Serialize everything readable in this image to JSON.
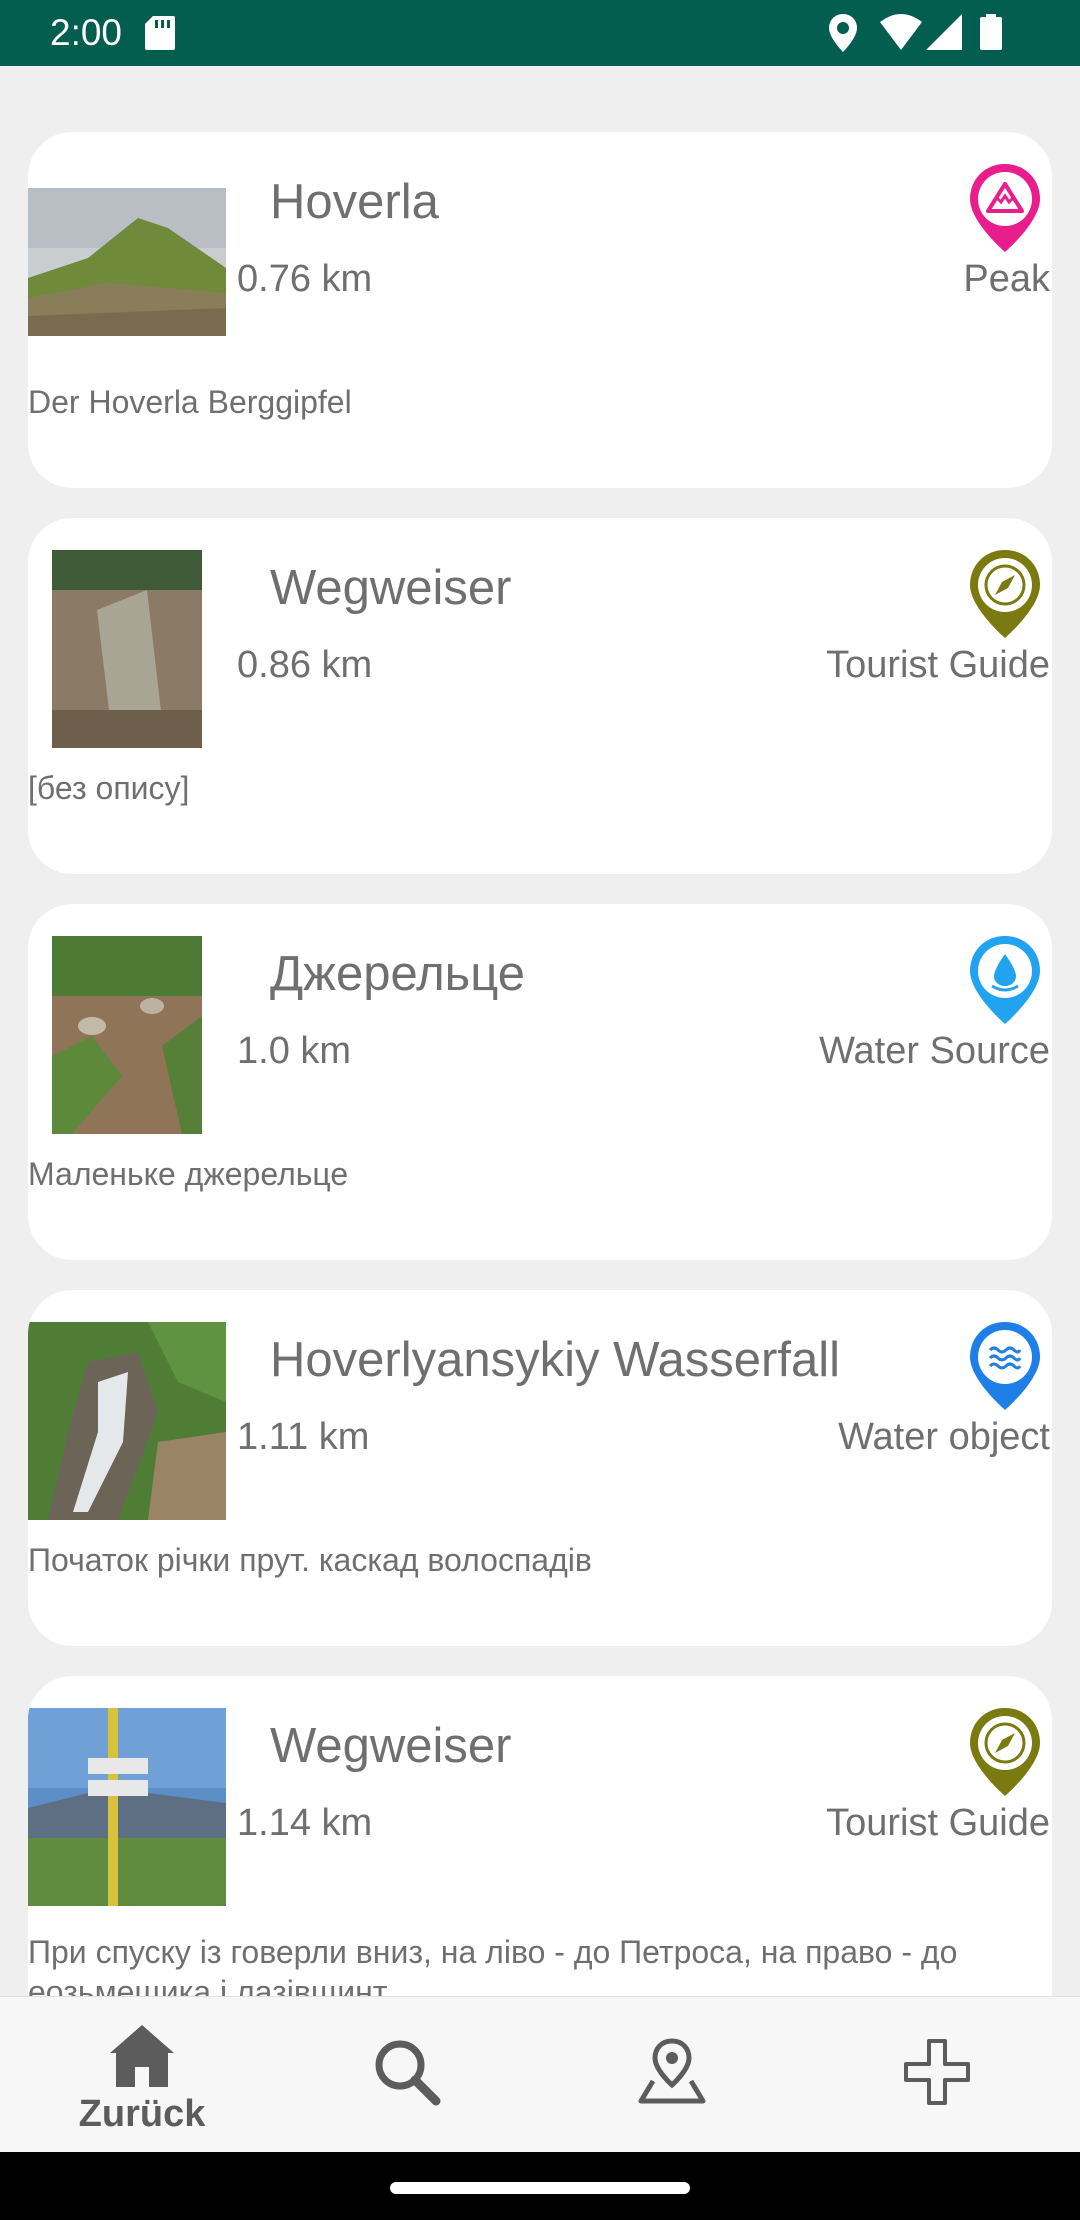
{
  "status_bar": {
    "time": "2:00"
  },
  "items": [
    {
      "title": "Hoverla",
      "distance": "0.76 km",
      "category": "Peak",
      "description": "Der Hoverla Berggipfel",
      "pin_color": "#e81e8c",
      "category_icon": "mountain-icon"
    },
    {
      "title": "Wegweiser",
      "distance": "0.86 km",
      "category": "Tourist Guide",
      "description": "[без опису]",
      "pin_color": "#7a7a10",
      "category_icon": "compass-icon"
    },
    {
      "title": "Джерельце",
      "distance": "1.0 km",
      "category": "Water Source",
      "description": "Маленьке джерельце",
      "pin_color": "#22a3f0",
      "category_icon": "water-drop-icon"
    },
    {
      "title": "Hoverlyansykiy Wasserfall",
      "distance": "1.11 km",
      "category": "Water object",
      "description": "Початок річки прут. каскад волоспадів",
      "pin_color": "#1e7fe6",
      "category_icon": "waves-icon"
    },
    {
      "title": "Wegweiser",
      "distance": "1.14 km",
      "category": "Tourist Guide",
      "description": "При спуску із говерли вниз, на ліво - до Петроса, на право - до еозьмещика і лазівщинт",
      "pin_color": "#7a7a10",
      "category_icon": "compass-icon"
    }
  ],
  "nav": {
    "home_label": "Zurück",
    "home_icon": "home-icon",
    "search_icon": "search-icon",
    "map_icon": "map-pin-icon",
    "add_icon": "plus-icon"
  }
}
